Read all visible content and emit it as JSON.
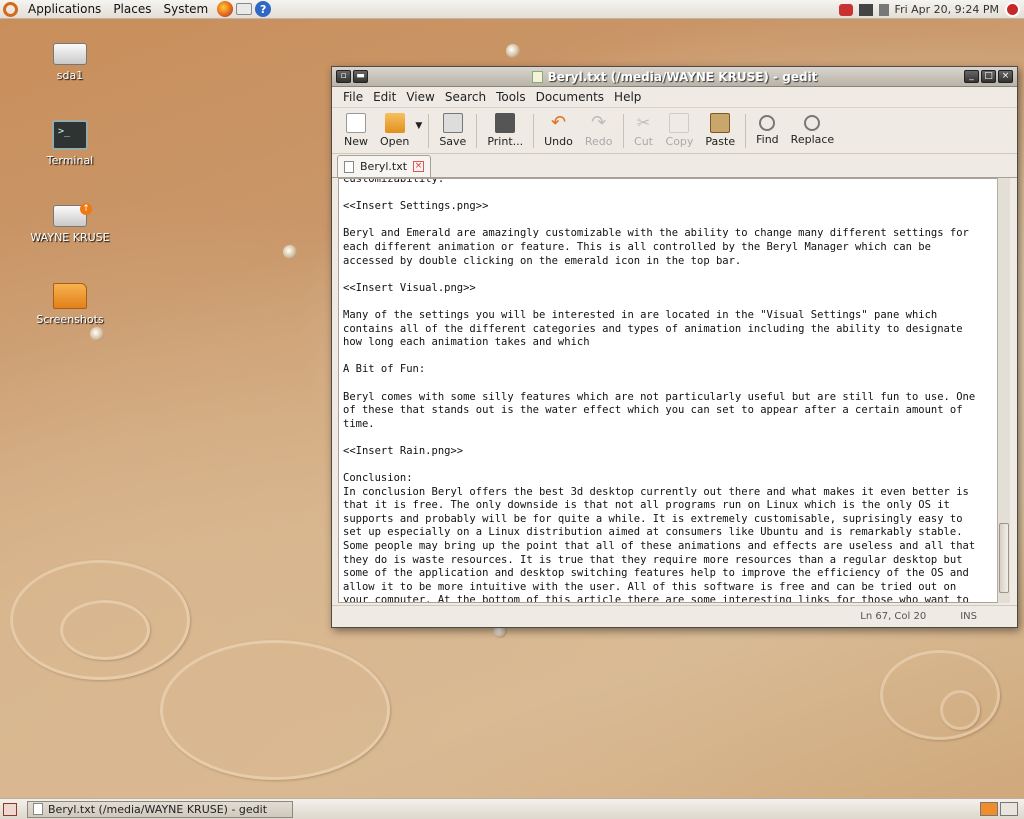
{
  "top_panel": {
    "menus": [
      "Applications",
      "Places",
      "System"
    ],
    "clock": "Fri Apr 20,  9:24 PM"
  },
  "desktop_icons": [
    {
      "label": "sda1"
    },
    {
      "label": "Terminal"
    },
    {
      "label": "WAYNE KRUSE"
    },
    {
      "label": "Screenshots"
    }
  ],
  "window": {
    "title": "Beryl.txt (/media/WAYNE KRUSE) - gedit",
    "menus": [
      "File",
      "Edit",
      "View",
      "Search",
      "Tools",
      "Documents",
      "Help"
    ],
    "toolbar": {
      "new": "New",
      "open": "Open",
      "save": "Save",
      "print": "Print...",
      "undo": "Undo",
      "redo": "Redo",
      "cut": "Cut",
      "copy": "Copy",
      "paste": "Paste",
      "find": "Find",
      "replace": "Replace"
    },
    "tab_label": "Beryl.txt",
    "text": "Customizability:\n\n<<Insert Settings.png>>\n\nBeryl and Emerald are amazingly customizable with the ability to change many different settings for\neach different animation or feature. This is all controlled by the Beryl Manager which can be\naccessed by double clicking on the emerald icon in the top bar.\n\n<<Insert Visual.png>>\n\nMany of the settings you will be interested in are located in the \"Visual Settings\" pane which\ncontains all of the different categories and types of animation including the ability to designate\nhow long each animation takes and which\n\nA Bit of Fun:\n\nBeryl comes with some silly features which are not particularly useful but are still fun to use. One\nof these that stands out is the water effect which you can set to appear after a certain amount of\ntime.\n\n<<Insert Rain.png>>\n\nConclusion:\nIn conclusion Beryl offers the best 3d desktop currently out there and what makes it even better is\nthat it is free. The only downside is that not all programs run on Linux which is the only OS it\nsupports and probably will be for quite a while. It is extremely customisable, suprisingly easy to\nset up especially on a Linux distribution aimed at consumers like Ubuntu and is remarkably stable.\nSome people may bring up the point that all of these animations and effects are useless and all that\nthey do is waste resources. It is true that they require more resources than a regular desktop but\nsome of the application and desktop switching features help to improve the efficiency of the OS and\nallow it to be more intuitive with the user. All of this software is free and can be tried out on\nyour computer. At the bottom of this article there are some interesting links for those who want to",
    "status_position": "Ln 67, Col 20",
    "status_mode": "INS"
  },
  "taskbar": {
    "task_label": "Beryl.txt (/media/WAYNE KRUSE) - gedit"
  }
}
